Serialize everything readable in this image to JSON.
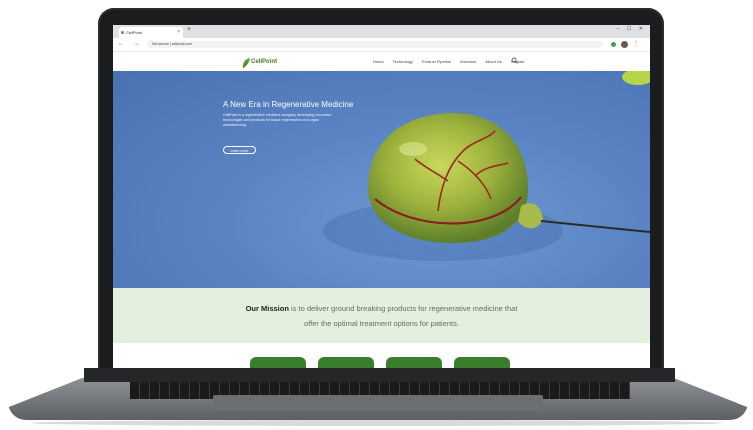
{
  "browser": {
    "tab_title": "CellPoint",
    "tab_close": "×",
    "new_tab": "+",
    "window_controls": "– ☐ ✕",
    "nav_buttons": "← → ↻",
    "url": "Not secure | cellpoint.com",
    "menu": "⋮"
  },
  "site": {
    "logo_text": "CellPoint",
    "nav": [
      "Home",
      "Technology",
      "Product Pipeline",
      "Investors",
      "About Us",
      "Contact"
    ]
  },
  "hero": {
    "title": "A New Era in Regenerative Medicine",
    "text": "CellPoint is a regenerative medicine company developing innovative technologies and products for tissue regeneration and organ manufacturing",
    "button": "Learn more"
  },
  "mission": {
    "lead": "Our Mission",
    "line1": " is to deliver ground breaking products for regenerative medicine that",
    "line2": "offer the optimal treatment options for patients."
  },
  "colors": {
    "accent_green": "#3a7d2c",
    "hero_blue": "#5a84c4",
    "mission_bg": "#e3efdf"
  },
  "icons": {
    "search": "search-icon",
    "logo": "leaf-logo-icon"
  }
}
